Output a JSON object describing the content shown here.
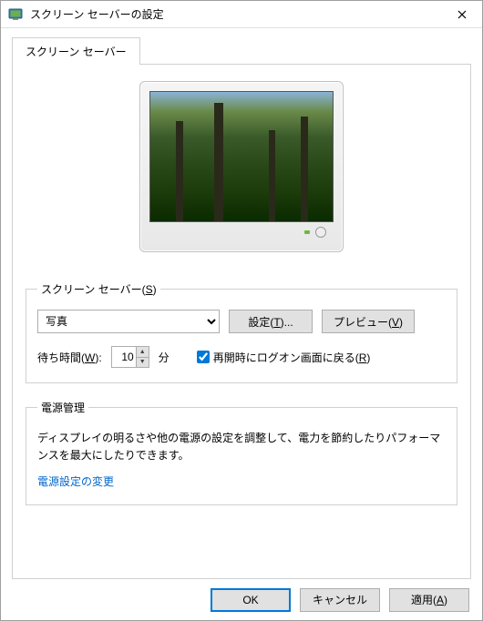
{
  "title": "スクリーン セーバーの設定",
  "tab_label": "スクリーン セーバー",
  "group_screensaver": {
    "legend_pre": "スクリーン セーバー(",
    "legend_key": "S",
    "legend_post": ")",
    "selected": "写真",
    "settings_btn_pre": "設定(",
    "settings_btn_key": "T",
    "settings_btn_post": ")...",
    "preview_btn_pre": "プレビュー(",
    "preview_btn_key": "V",
    "preview_btn_post": ")",
    "wait_label_pre": "待ち時間(",
    "wait_label_key": "W",
    "wait_label_post": "):",
    "wait_value": "10",
    "wait_unit": "分",
    "resume_checked": true,
    "resume_label_pre": "再開時にログオン画面に戻る(",
    "resume_label_key": "R",
    "resume_label_post": ")"
  },
  "group_power": {
    "legend": "電源管理",
    "desc": "ディスプレイの明るさや他の電源の設定を調整して、電力を節約したりパフォーマンスを最大にしたりできます。",
    "link": "電源設定の変更"
  },
  "buttons": {
    "ok": "OK",
    "cancel": "キャンセル",
    "apply_pre": "適用(",
    "apply_key": "A",
    "apply_post": ")"
  }
}
